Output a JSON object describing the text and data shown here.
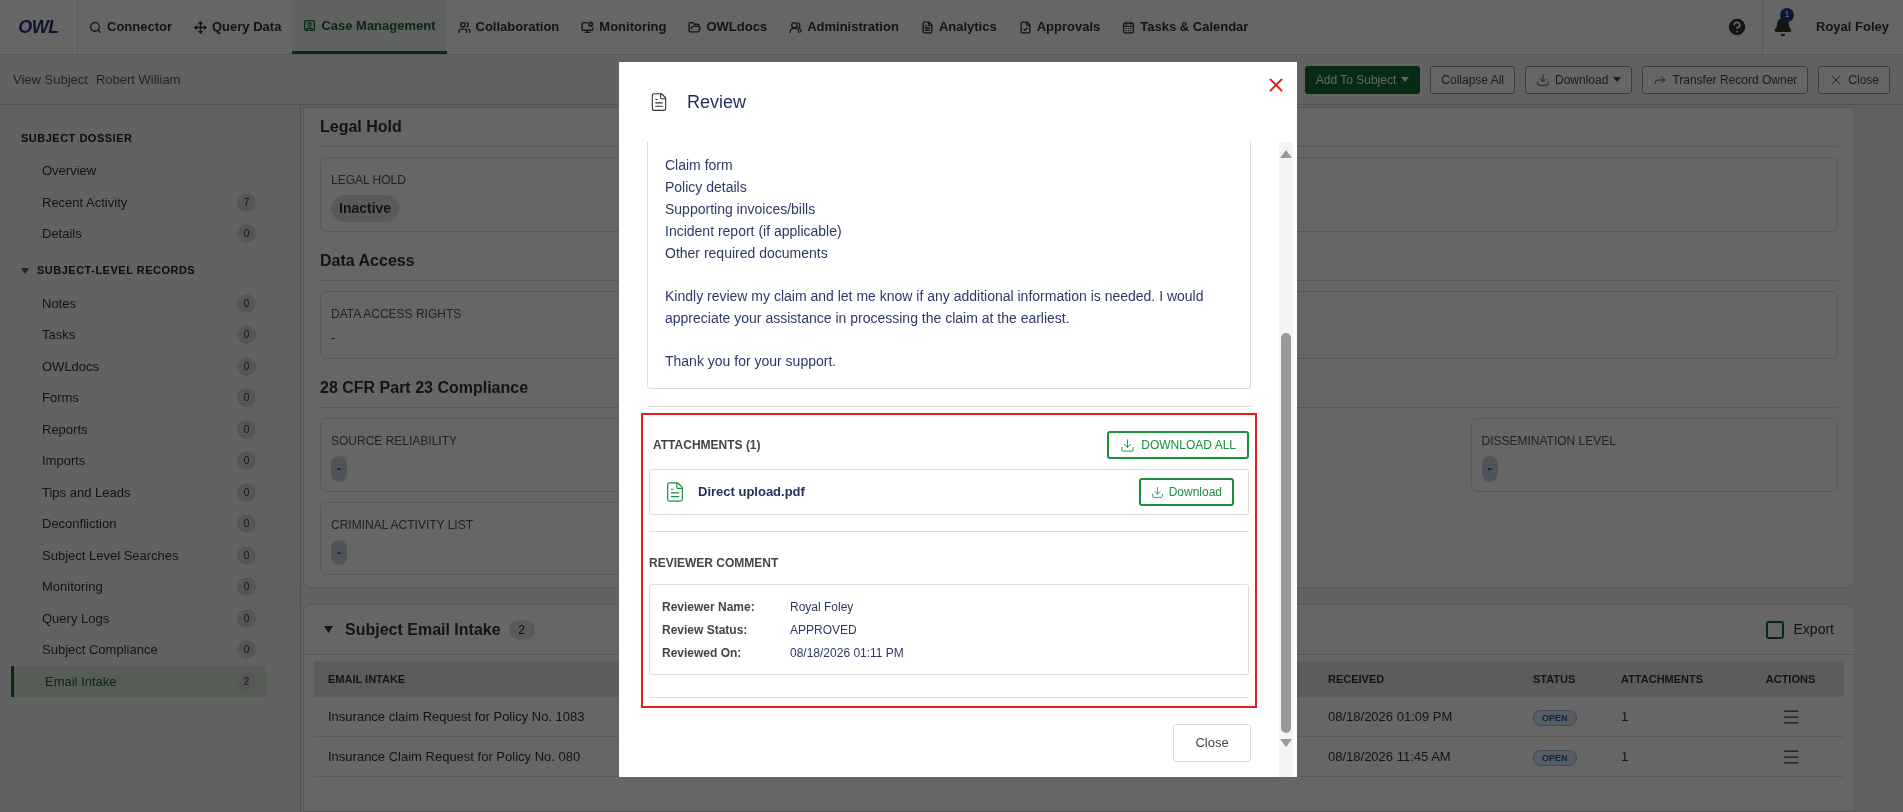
{
  "nav": {
    "logo": "OWL",
    "items": [
      {
        "label": "Connector",
        "selected": false
      },
      {
        "label": "Query Data",
        "selected": false
      },
      {
        "label": "Case Management",
        "selected": true
      },
      {
        "label": "Collaboration",
        "selected": false
      },
      {
        "label": "Monitoring",
        "selected": false
      },
      {
        "label": "OWLdocs",
        "selected": false
      },
      {
        "label": "Administration",
        "selected": false
      },
      {
        "label": "Analytics",
        "selected": false
      },
      {
        "label": "Approvals",
        "selected": false
      },
      {
        "label": "Tasks & Calendar",
        "selected": false
      }
    ],
    "notification_count": "1",
    "user": "Royal Foley"
  },
  "subheader": {
    "label": "View Subject",
    "subject": "Robert William",
    "buttons": [
      {
        "label": "Add To Subject",
        "kind": "primary",
        "caret": true
      },
      {
        "label": "Collapse All",
        "kind": "plain",
        "caret": false
      },
      {
        "label": "Download",
        "kind": "download",
        "caret": true
      },
      {
        "label": "Transfer Record Owner",
        "kind": "transfer",
        "caret": false
      },
      {
        "label": "Close",
        "kind": "close",
        "caret": false
      }
    ]
  },
  "sidebar": {
    "sections": [
      {
        "title": "SUBJECT DOSSIER",
        "items": [
          {
            "label": "Overview",
            "selected": false
          },
          {
            "label": "Recent Activity",
            "count": "7",
            "selected": false
          },
          {
            "label": "Details",
            "count": "0",
            "selected": false
          }
        ]
      },
      {
        "title": "SUBJECT-LEVEL RECORDS",
        "expanded": true,
        "items": [
          {
            "label": "Notes",
            "count": "0",
            "selected": false
          },
          {
            "label": "Tasks",
            "count": "0",
            "selected": false
          },
          {
            "label": "OWLdocs",
            "count": "0",
            "selected": false
          },
          {
            "label": "Forms",
            "count": "0",
            "selected": false
          },
          {
            "label": "Reports",
            "count": "0",
            "selected": false
          },
          {
            "label": "Imports",
            "count": "0",
            "selected": false
          },
          {
            "label": "Tips and Leads",
            "count": "0",
            "selected": false
          },
          {
            "label": "Deconfliction",
            "count": "0",
            "selected": false
          },
          {
            "label": "Subject Level Searches",
            "count": "0",
            "selected": false
          },
          {
            "label": "Monitoring",
            "count": "0",
            "selected": false
          },
          {
            "label": "Query Logs",
            "count": "0",
            "selected": false
          },
          {
            "label": "Subject Compliance",
            "count": "0",
            "selected": false
          },
          {
            "label": "Email Intake",
            "count": "2",
            "selected": true
          }
        ]
      }
    ]
  },
  "sections": [
    {
      "title": "Legal Hold",
      "rows": [
        [
          {
            "label": "LEGAL HOLD",
            "value": "Inactive",
            "kind": "status"
          }
        ]
      ]
    },
    {
      "title": "Data Access",
      "rows": [
        [
          {
            "label": "DATA ACCESS RIGHTS",
            "value": "-",
            "kind": "plain"
          }
        ]
      ]
    },
    {
      "title": "28 CFR Part 23 Compliance",
      "rows": [
        [
          {
            "label": "SOURCE RELIABILITY",
            "value": "-",
            "kind": "chip"
          },
          {
            "label": "DISSEMINATION LEVEL",
            "value": "-",
            "kind": "chip"
          }
        ],
        [
          {
            "label": "CRIMINAL ACTIVITY LIST",
            "value": "-",
            "kind": "chip"
          }
        ]
      ]
    }
  ],
  "email_intake": {
    "title": "Subject Email Intake",
    "count": "2",
    "expanded": true,
    "export": {
      "label": "Export",
      "checked": false
    },
    "columns": [
      "EMAIL INTAKE",
      "RECEIVED",
      "STATUS",
      "ATTACHMENTS",
      "ACTIONS"
    ],
    "rows": [
      {
        "email_intake": "Insurance claim Request for Policy No. 1083",
        "received": "08/18/2026 01:09 PM",
        "status": "OPEN",
        "attachments": "1"
      },
      {
        "email_intake": "Insurance Claim Request for Policy No. 080",
        "received": "08/18/2026 11:45 AM",
        "status": "OPEN",
        "attachments": "1"
      }
    ]
  },
  "modal": {
    "title": "Review",
    "message_lines": [
      "Claim form",
      "Policy details",
      "Supporting invoices/bills",
      "Incident report (if applicable)",
      "Other required documents"
    ],
    "message_paragraphs": [
      "Kindly review my claim and let me know if any additional information is needed. I would appreciate your assistance in processing the claim at the earliest.",
      "Thank you for your support."
    ],
    "attachments": {
      "title": "ATTACHMENTS (1)",
      "download_all": "DOWNLOAD ALL",
      "files": [
        {
          "name": "Direct upload.pdf",
          "action": "Download"
        }
      ]
    },
    "reviewer": {
      "title": "REVIEWER COMMENT",
      "fields": [
        {
          "label": "Reviewer Name:",
          "value": "Royal Foley"
        },
        {
          "label": "Review Status:",
          "value": "APPROVED"
        },
        {
          "label": "Reviewed On:",
          "value": "08/18/2026 01:11 PM"
        }
      ]
    },
    "close": "Close"
  }
}
